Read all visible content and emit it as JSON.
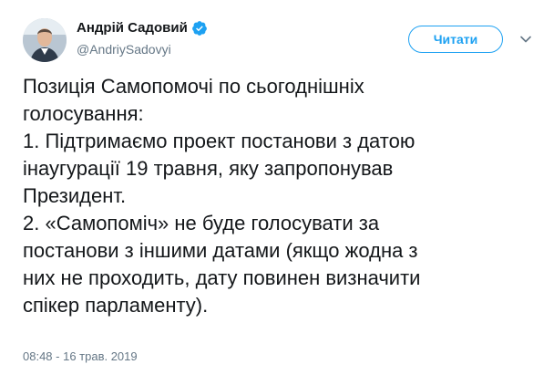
{
  "user": {
    "display_name": "Андрій Садовий",
    "handle": "@AndriySadovyi",
    "verified": true
  },
  "follow_button": {
    "label": "Читати"
  },
  "tweet": {
    "lines": [
      "Позиція Самопомочі по сьогоднішніх",
      "голосування:",
      "1. Підтримаємо проект постанови з датою",
      "інаугурації 19 травня, яку запропонував",
      "Президент.",
      "2. «Самопоміч» не буде голосувати за",
      "постанови з іншими датами (якщо жодна з",
      "них не проходить, дату повинен визначити",
      "спікер парламенту)."
    ],
    "timestamp": "08:48 - 16 трав. 2019"
  },
  "icons": {
    "verified": "verified-badge-icon",
    "caret": "chevron-down-icon"
  },
  "colors": {
    "accent": "#1da1f2",
    "text": "#14171a",
    "muted": "#657786"
  }
}
